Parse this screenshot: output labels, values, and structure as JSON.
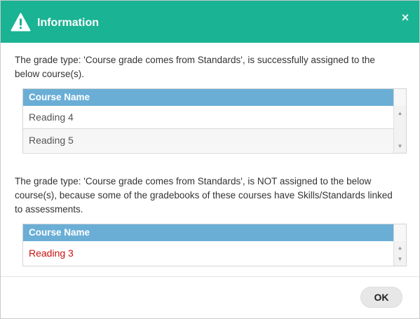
{
  "dialog": {
    "title": "Information",
    "icon": "warning-triangle-icon",
    "close_label": "×",
    "header_color": "#1ab394"
  },
  "success": {
    "message": "The grade type: 'Course grade comes from Standards', is successfully assigned to the below course(s).",
    "column_header": "Course Name",
    "rows": [
      "Reading 4",
      "Reading 5"
    ]
  },
  "failure": {
    "message": "The grade type: 'Course grade comes from Standards', is NOT assigned to the below course(s), because some of the gradebooks of these courses have Skills/Standards linked to assessments.",
    "column_header": "Course Name",
    "rows": [
      "Reading 3"
    ],
    "row_color": "#cc1111"
  },
  "footer": {
    "ok_label": "OK"
  }
}
